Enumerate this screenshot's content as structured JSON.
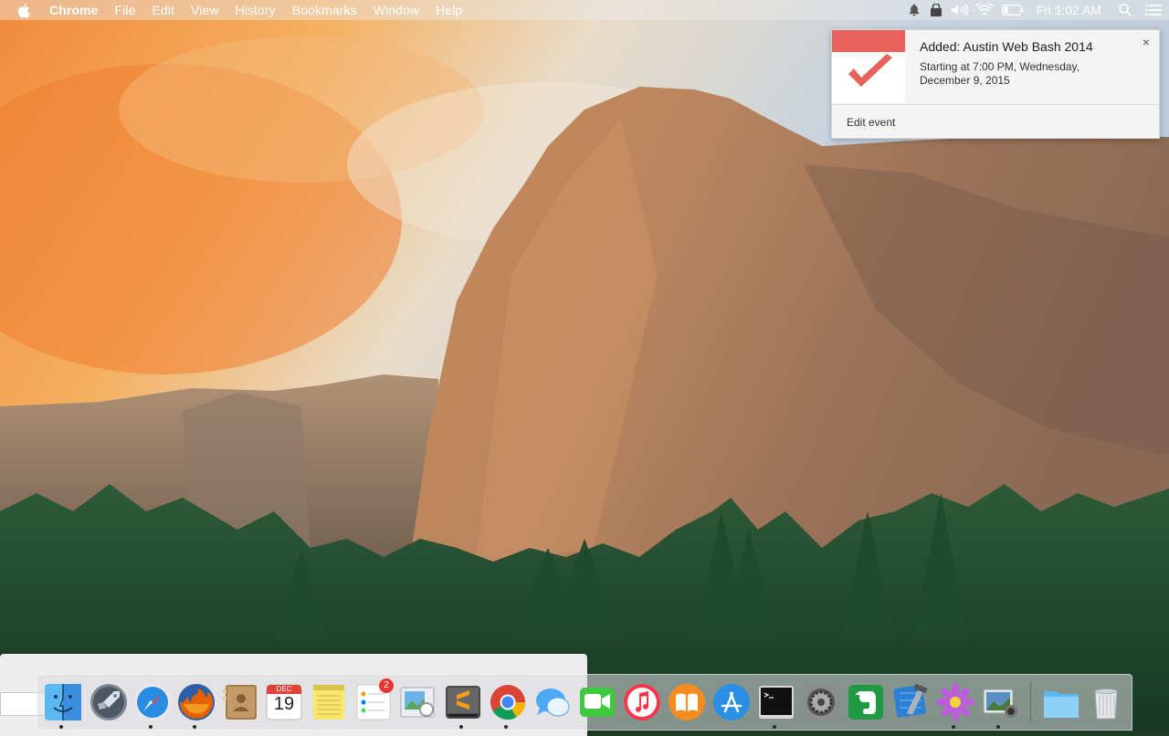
{
  "menubar": {
    "app_name": "Chrome",
    "menus": [
      "File",
      "Edit",
      "View",
      "History",
      "Bookmarks",
      "Window",
      "Help"
    ],
    "clock": "Fri 1:02 AM"
  },
  "notification": {
    "title": "Added: Austin Web Bash 2014",
    "body": "Starting at 7:00 PM, Wednesday, December 9, 2015",
    "action": "Edit event",
    "close_label": "×",
    "accent_color": "#e8615b"
  },
  "dock": {
    "calendar_month": "DEC",
    "calendar_day": "19",
    "reminders_badge": "2",
    "items": [
      "finder-icon",
      "launchpad-icon",
      "safari-icon",
      "firefox-icon",
      "contacts-icon",
      "calendar-icon",
      "notes-icon",
      "reminders-icon",
      "preview-icon",
      "sublime-text-icon",
      "chrome-icon",
      "messages-icon",
      "facetime-icon",
      "itunes-icon",
      "ibooks-icon",
      "app-store-icon",
      "terminal-icon",
      "system-preferences-icon",
      "evernote-icon",
      "xcode-icon",
      "flower-icon",
      "image-capture-icon",
      "downloads-folder-icon",
      "trash-icon"
    ]
  }
}
